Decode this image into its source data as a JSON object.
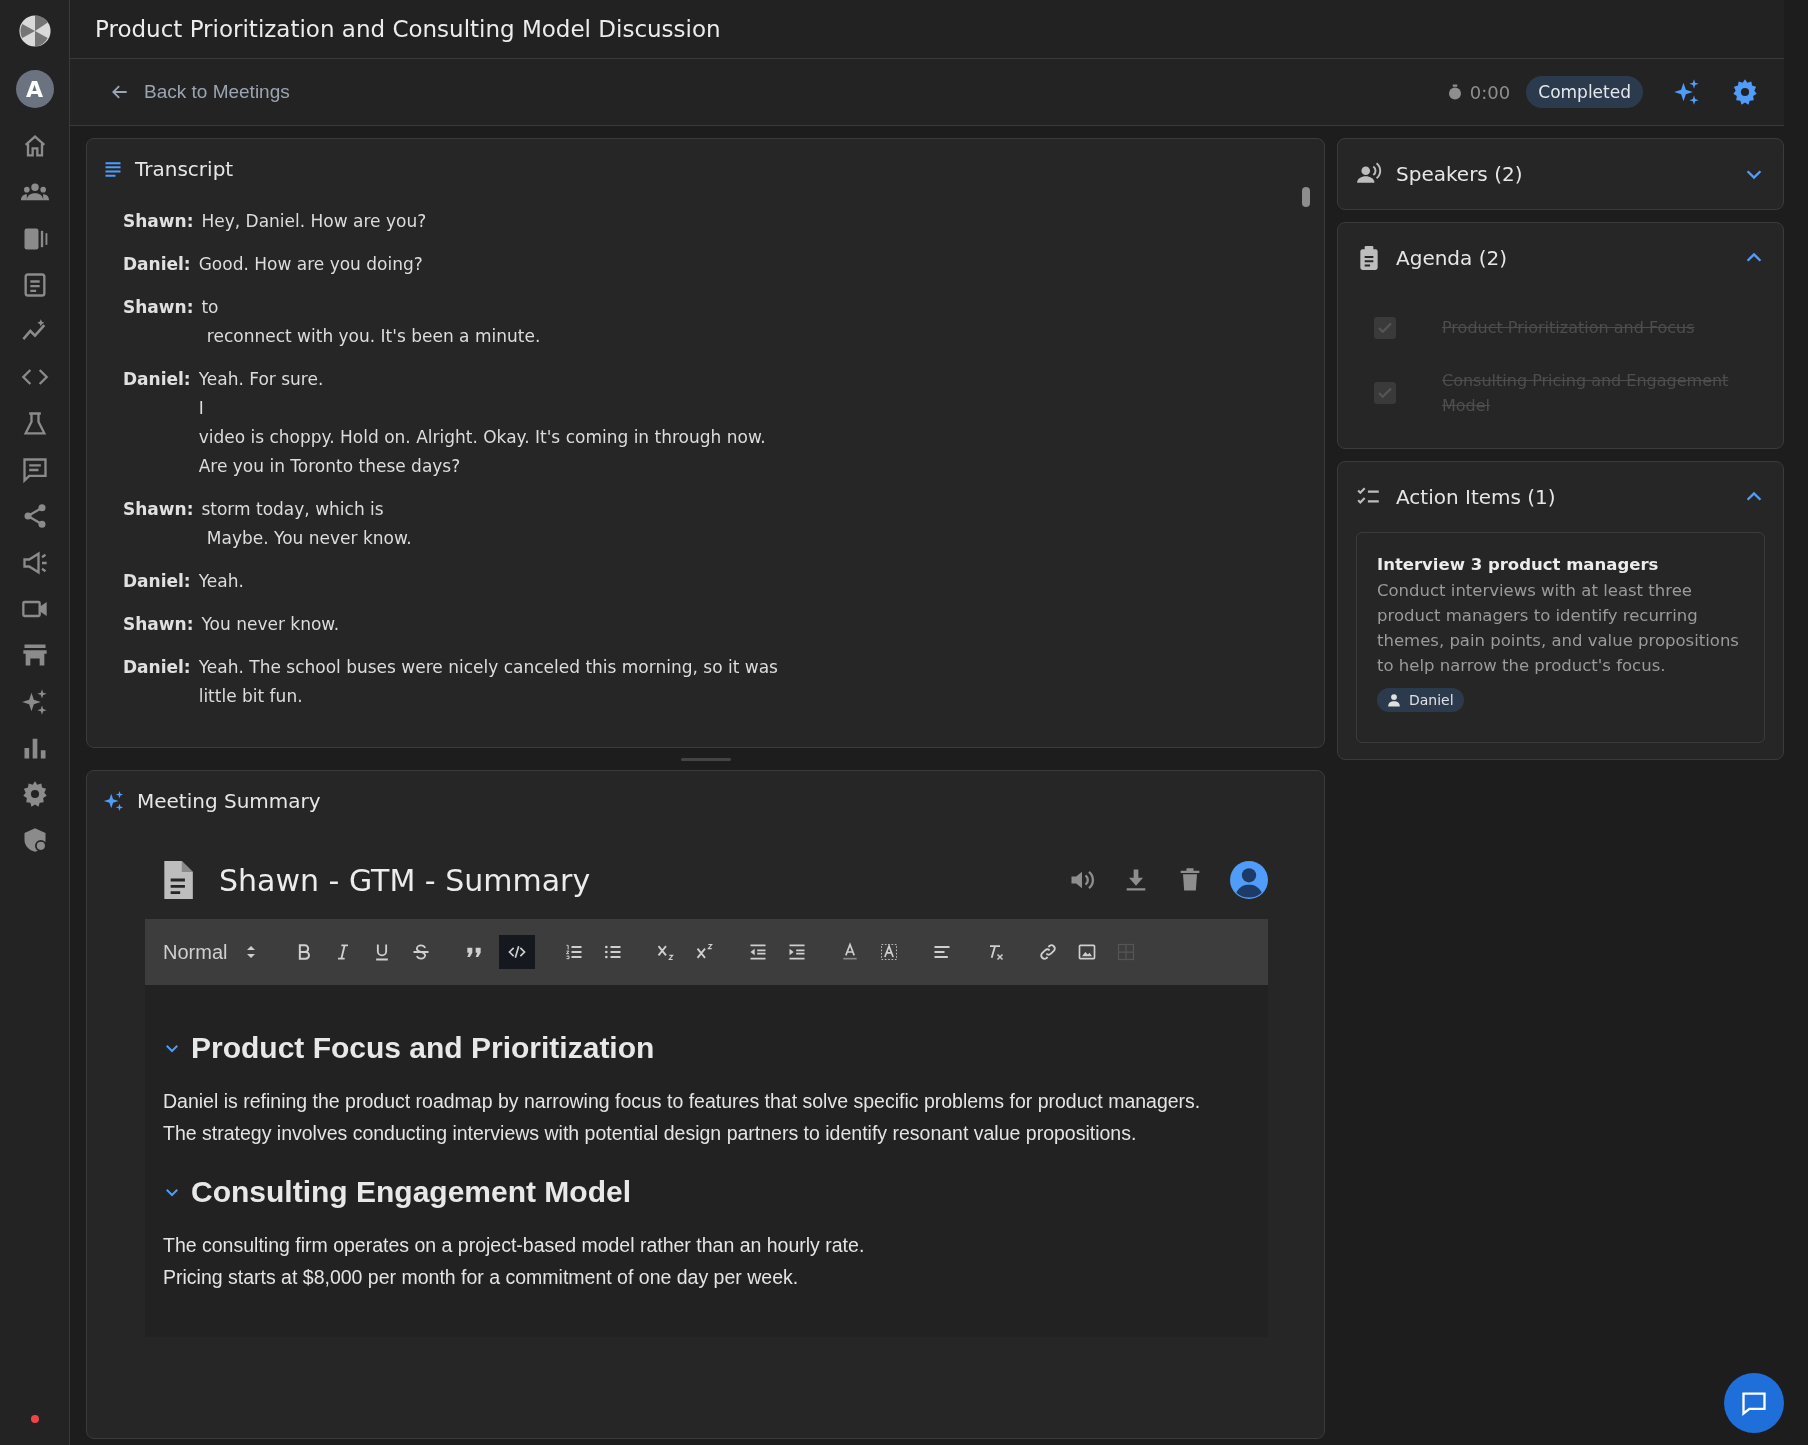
{
  "sidebar": {
    "avatar": "A"
  },
  "header": {
    "title": "Product Prioritization and Consulting Model Discussion"
  },
  "toolbar": {
    "back": "Back to Meetings",
    "timer": "0:00",
    "status": "Completed"
  },
  "transcript": {
    "title": "Transcript",
    "entries": [
      {
        "speaker": "Shawn:",
        "lines": [
          "Hey, Daniel. How are you?"
        ]
      },
      {
        "speaker": "Daniel:",
        "lines": [
          "Good. How are you doing?"
        ]
      },
      {
        "speaker": "Shawn:",
        "lines": [
          "to",
          " reconnect with you. It's been a minute."
        ]
      },
      {
        "speaker": "Daniel:",
        "lines": [
          "Yeah. For sure.",
          "I",
          "video is choppy. Hold on. Alright. Okay. It's coming in through now.",
          "Are you in Toronto these days?"
        ]
      },
      {
        "speaker": "Shawn:",
        "lines": [
          "storm today, which is",
          " Maybe. You never know."
        ]
      },
      {
        "speaker": "Daniel:",
        "lines": [
          "Yeah."
        ]
      },
      {
        "speaker": "Shawn:",
        "lines": [
          "You never know."
        ]
      },
      {
        "speaker": "Daniel:",
        "lines": [
          "Yeah. The school buses were nicely canceled this morning, so it was",
          "little bit fun."
        ]
      }
    ]
  },
  "summary": {
    "title": "Meeting Summary",
    "document": "Shawn - GTM - Summary",
    "format": "Normal",
    "tools": [
      {
        "kind": "bold",
        "active": false,
        "disabled": false
      },
      {
        "kind": "italic",
        "active": false,
        "disabled": false
      },
      {
        "kind": "underline",
        "active": false,
        "disabled": false
      },
      {
        "kind": "strike",
        "active": false,
        "disabled": false
      },
      {
        "kind": "quote",
        "active": false,
        "disabled": false
      },
      {
        "kind": "code",
        "active": true,
        "disabled": false
      },
      {
        "kind": "ordered",
        "active": false,
        "disabled": false
      },
      {
        "kind": "bullet",
        "active": false,
        "disabled": false
      },
      {
        "kind": "sub",
        "active": false,
        "disabled": false
      },
      {
        "kind": "sup",
        "active": false,
        "disabled": false
      },
      {
        "kind": "outdent",
        "active": false,
        "disabled": false
      },
      {
        "kind": "indent",
        "active": false,
        "disabled": false
      },
      {
        "kind": "color",
        "active": false,
        "disabled": false
      },
      {
        "kind": "background",
        "active": false,
        "disabled": false
      },
      {
        "kind": "align",
        "active": false,
        "disabled": false
      },
      {
        "kind": "clear",
        "active": false,
        "disabled": false
      },
      {
        "kind": "link",
        "active": false,
        "disabled": false
      },
      {
        "kind": "image",
        "active": false,
        "disabled": false
      },
      {
        "kind": "table",
        "active": false,
        "disabled": true
      }
    ],
    "sections": [
      {
        "heading": "Product Focus and Prioritization",
        "expanded": true,
        "lines": [
          "Daniel is refining the product roadmap by narrowing focus to features that solve specific problems for product managers.",
          "The strategy involves conducting interviews with potential design partners to identify resonant value propositions."
        ]
      },
      {
        "heading": "Consulting Engagement Model",
        "expanded": true,
        "lines": [
          "The consulting firm operates on a project-based model rather than an hourly rate.",
          "Pricing starts at $8,000 per month for a commitment of one day per week."
        ]
      }
    ]
  },
  "speakers": {
    "title": "Speakers (2)",
    "expanded": false
  },
  "agenda": {
    "title": "Agenda (2)",
    "expanded": true,
    "items": [
      {
        "text": "Product Prioritization and Focus",
        "checked": true
      },
      {
        "text": "Consulting Pricing and Engagement Model",
        "checked": true
      }
    ]
  },
  "action_items": {
    "title": "Action Items (1)",
    "expanded": true,
    "items": [
      {
        "title": "Interview 3 product managers",
        "description": "Conduct interviews with at least three product managers to identify recurring themes, pain points, and value propositions to help narrow the product's focus.",
        "assignee": "Daniel"
      }
    ]
  }
}
